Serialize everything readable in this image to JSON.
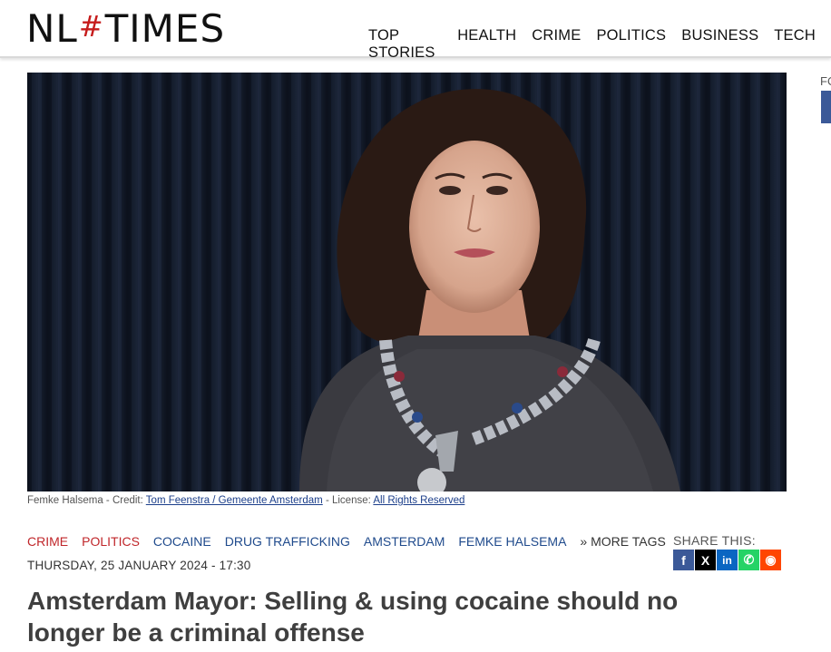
{
  "header": {
    "logo_left": "NL",
    "logo_hash": "#",
    "logo_right": "TIMES",
    "nav": [
      "TOP STORIES",
      "HEALTH",
      "CRIME",
      "POLITICS",
      "BUSINESS",
      "TECH"
    ]
  },
  "caption": {
    "person": "Femke Halsema",
    "credit_prefix": " - Credit: ",
    "credit_link": "Tom Feenstra / Gemeente Amsterdam",
    "license_prefix": " - License: ",
    "license_link": "All Rights Reserved"
  },
  "article": {
    "tags": [
      {
        "label": "CRIME",
        "color": "#c0262a"
      },
      {
        "label": "POLITICS",
        "color": "#c0262a"
      },
      {
        "label": "COCAINE",
        "color": "#1f4a8c"
      },
      {
        "label": "DRUG TRAFFICKING",
        "color": "#1f4a8c"
      },
      {
        "label": "AMSTERDAM",
        "color": "#1f4a8c"
      },
      {
        "label": "FEMKE HALSEMA",
        "color": "#1f4a8c"
      }
    ],
    "more_tags": "» MORE TAGS",
    "date": "THURSDAY, 25 JANUARY 2024 - 17:30",
    "title": "Amsterdam Mayor: Selling & using cocaine should no longer be a criminal offense"
  },
  "share": {
    "label": "SHARE THIS:",
    "buttons": [
      {
        "icon": "facebook-icon",
        "glyph": "f",
        "color": "#3b5998"
      },
      {
        "icon": "x-icon",
        "glyph": "X",
        "color": "#000000"
      },
      {
        "icon": "linkedin-icon",
        "glyph": "in",
        "color": "#0a66c2"
      },
      {
        "icon": "whatsapp-icon",
        "glyph": "✆",
        "color": "#25d366"
      },
      {
        "icon": "reddit-icon",
        "glyph": "◉",
        "color": "#ff4500"
      }
    ]
  },
  "sidebar": {
    "label": "FO"
  }
}
